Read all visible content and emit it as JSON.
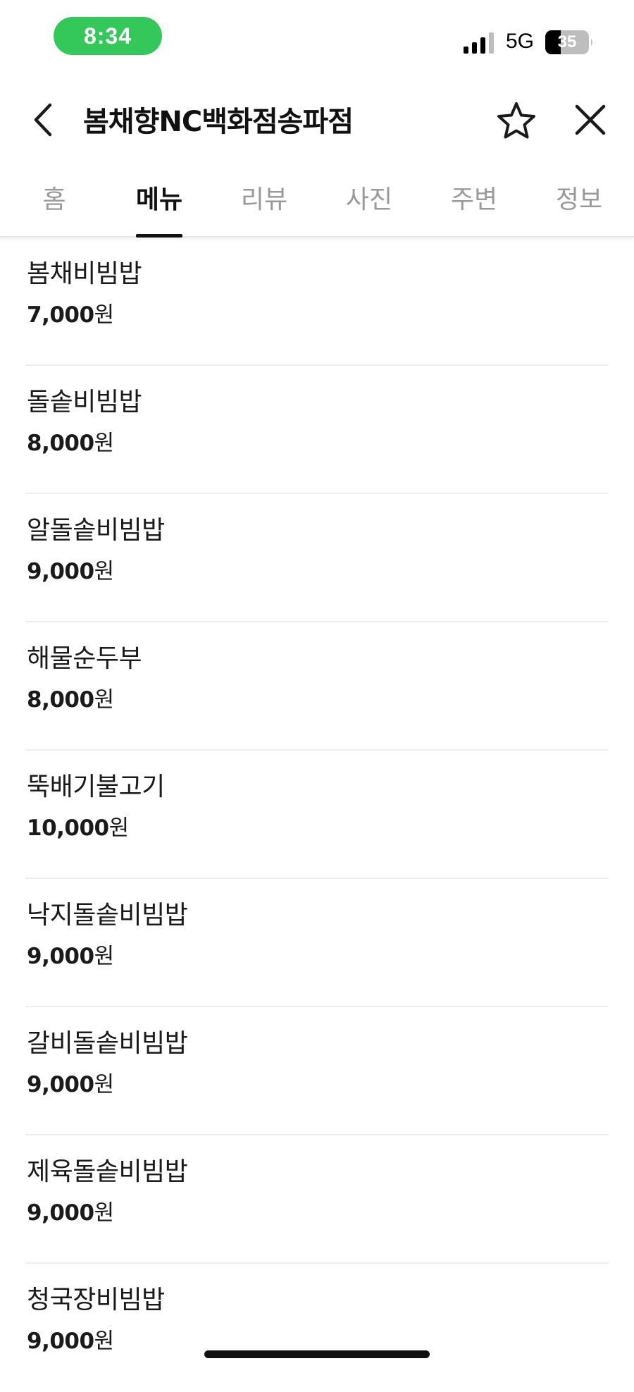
{
  "status_bar": {
    "time": "8:34",
    "network": "5G",
    "battery_level": "35",
    "accent_color": "#34c759"
  },
  "header": {
    "title": "봄채향NC백화점송파점",
    "back_icon": "chevron-left-icon",
    "favorite_icon": "star-outline-icon",
    "close_icon": "close-icon"
  },
  "tabs": [
    {
      "label": "홈",
      "active": false
    },
    {
      "label": "메뉴",
      "active": true
    },
    {
      "label": "리뷰",
      "active": false
    },
    {
      "label": "사진",
      "active": false
    },
    {
      "label": "주변",
      "active": false
    },
    {
      "label": "정보",
      "active": false
    }
  ],
  "menu": {
    "items": [
      {
        "name": "봄채비빔밥",
        "price": "7,000",
        "unit": "원"
      },
      {
        "name": "돌솥비빔밥",
        "price": "8,000",
        "unit": "원"
      },
      {
        "name": "알돌솥비빔밥",
        "price": "9,000",
        "unit": "원"
      },
      {
        "name": "해물순두부",
        "price": "8,000",
        "unit": "원"
      },
      {
        "name": "뚝배기불고기",
        "price": "10,000",
        "unit": "원"
      },
      {
        "name": "낙지돌솥비빔밥",
        "price": "9,000",
        "unit": "원"
      },
      {
        "name": "갈비돌솥비빔밥",
        "price": "9,000",
        "unit": "원"
      },
      {
        "name": "제육돌솥비빔밥",
        "price": "9,000",
        "unit": "원"
      },
      {
        "name": "청국장비빔밥",
        "price": "9,000",
        "unit": "원"
      }
    ]
  }
}
